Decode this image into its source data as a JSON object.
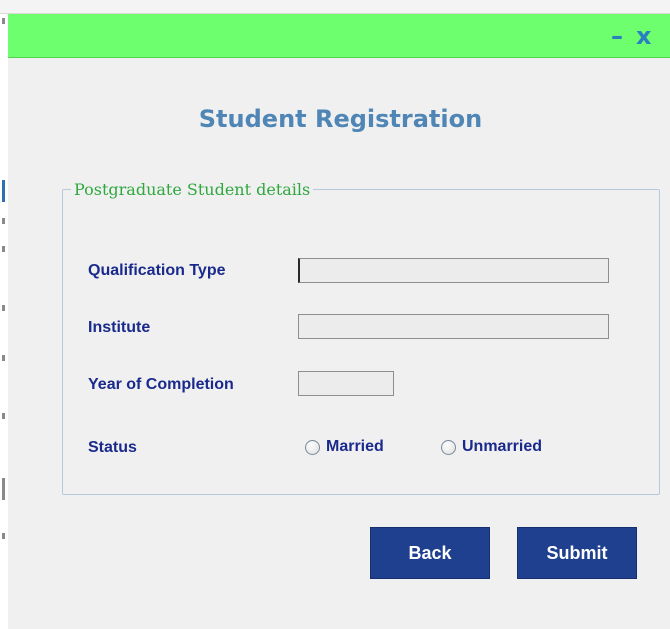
{
  "window": {
    "minimize_glyph": "–",
    "close_glyph": "x",
    "titlebar_color": "#6dff6d",
    "accent_color": "#2a7fc0"
  },
  "form": {
    "title": "Student Registration",
    "section_legend": "Postgraduate Student details",
    "fields": [
      {
        "label": "Qualification Type",
        "value": ""
      },
      {
        "label": "Institute",
        "value": ""
      },
      {
        "label": "Year of Completion",
        "value": ""
      }
    ],
    "status": {
      "label": "Status",
      "options": [
        "Married",
        "Unmarried"
      ],
      "selected": null
    }
  },
  "buttons": {
    "back": "Back",
    "submit": "Submit",
    "color": "#1f3f8f"
  }
}
